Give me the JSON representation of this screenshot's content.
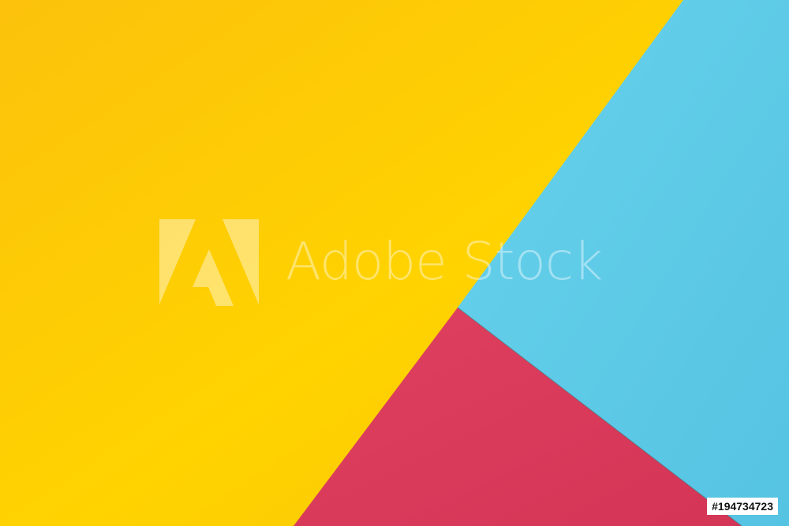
{
  "image": {
    "alt": "Flat lay of yellow, light blue and red colored paper sheets"
  },
  "watermark": {
    "logo_icon": "adobe-a-logo-icon",
    "text": "Adobe Stock"
  },
  "stock_id": "#194734723",
  "colors": {
    "yellow": "#FDC90A",
    "blue": "#5FCBE6",
    "red": "#DB3A5B"
  }
}
